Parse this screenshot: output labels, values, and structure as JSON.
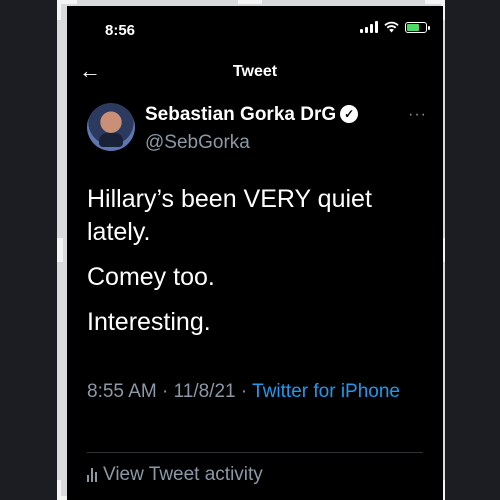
{
  "status_bar": {
    "time": "8:56"
  },
  "header": {
    "title": "Tweet"
  },
  "author": {
    "name": "Sebastian Gorka DrG",
    "handle": "@SebGorka"
  },
  "tweet": {
    "paragraphs": [
      "Hillary’s been VERY quiet lately.",
      "Comey too.",
      "Interesting."
    ],
    "time": "8:55 AM",
    "date": "11/8/21",
    "source": "Twitter for iPhone"
  },
  "activity": {
    "label": "View Tweet activity"
  },
  "colors": {
    "link": "#1d9bf0",
    "secondary": "#8b98a5",
    "battery": "#4cd964"
  },
  "icons": [
    "back-arrow-icon",
    "verified-badge-icon",
    "more-icon",
    "signal-icon",
    "wifi-icon",
    "battery-icon",
    "analytics-icon"
  ]
}
